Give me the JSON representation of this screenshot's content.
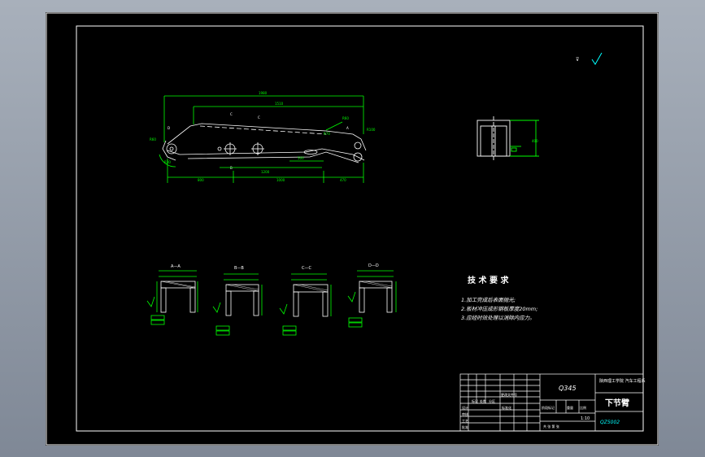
{
  "drawing": {
    "part_name": "下节臂",
    "material": "Q345",
    "scale": "1:10",
    "drawing_number": "QZ5002",
    "company": "陕西理工学院 汽车工程系",
    "roughness_symbol": "⊽"
  },
  "tech_requirements": {
    "title": "技 术 要 求",
    "items": [
      "1.加工完成后表面抛光;",
      "2.板材冲压成形钢板厚度20mm;",
      "3.应经时效处理以消除内应力。"
    ]
  },
  "sections": [
    {
      "label": "A—A"
    },
    {
      "label": "B—B"
    },
    {
      "label": "C—C"
    },
    {
      "label": "D—D"
    }
  ],
  "title_block": {
    "mark_label": "标记",
    "count_label": "处数",
    "zone_label": "分区",
    "doc_label": "更改文件号",
    "sign_label": "签名",
    "date_label": "年月日",
    "design_label": "设计",
    "std_label": "标准化",
    "check_label": "审核",
    "process_label": "工艺",
    "approve_label": "批准",
    "stage_label": "阶段标记",
    "weight_label": "重量",
    "scale_label": "比例",
    "sheets_label": "共 张 第 张"
  },
  "colors": {
    "background": "#000000",
    "border": "#ffffff",
    "outline": "#ffffff",
    "dimension": "#00ff00",
    "annotation": "#00ffff",
    "window": "#8c96a4"
  }
}
